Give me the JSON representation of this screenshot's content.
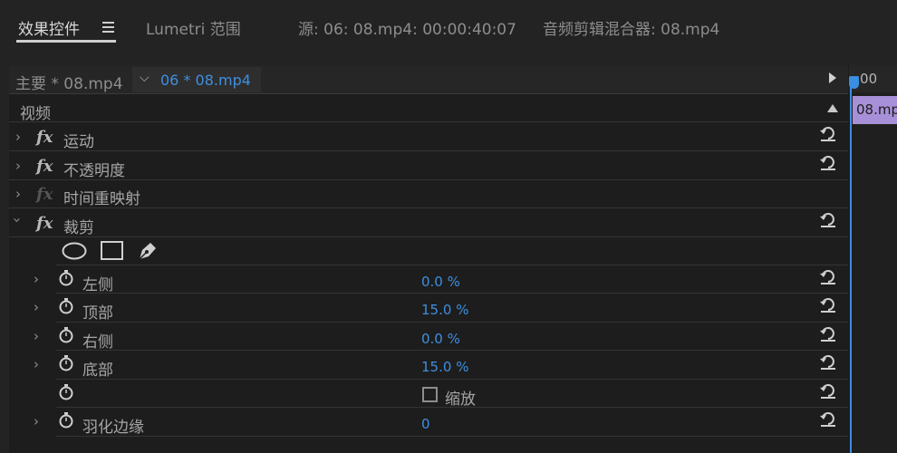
{
  "tabs": [
    {
      "label": "效果控件",
      "active": true
    },
    {
      "label": "Lumetri 范围"
    },
    {
      "label": "源: 06: 08.mp4: 00:00:40:07"
    },
    {
      "label": "音频剪辑混合器: 08.mp4"
    }
  ],
  "sequence": {
    "main": "主要 * 08.mp4",
    "clip": "06 * 08.mp4"
  },
  "timeline": {
    "timecode": ":00",
    "clip_label": "08.mp"
  },
  "section": {
    "label": "视频"
  },
  "effects": [
    {
      "label": "运动"
    },
    {
      "label": "不透明度"
    },
    {
      "label": "时间重映射"
    },
    {
      "label": "裁剪"
    }
  ],
  "crop_props": [
    {
      "label": "左侧",
      "value": "0.0",
      "unit": "%"
    },
    {
      "label": "顶部",
      "value": "15.0",
      "unit": "%"
    },
    {
      "label": "右侧",
      "value": "0.0",
      "unit": "%"
    },
    {
      "label": "底部",
      "value": "15.0",
      "unit": "%"
    }
  ],
  "zoom_label": "缩放",
  "feather": {
    "label": "羽化边缘",
    "value": "0"
  },
  "colors": {
    "accent": "#3f8fe0",
    "clip": "#a890d8",
    "panel": "#1d1d1d"
  }
}
